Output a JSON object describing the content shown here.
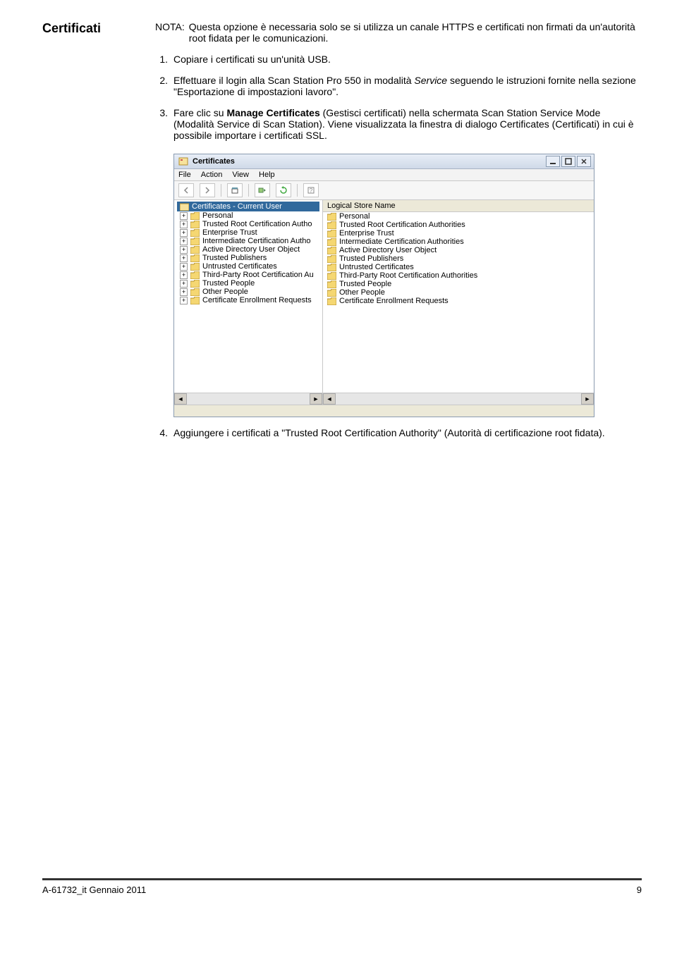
{
  "section_heading": "Certificati",
  "note": {
    "label": "NOTA:",
    "text": "Questa opzione è necessaria solo se si utilizza un canale HTTPS e certificati non firmati da un'autorità root fidata per le comunicazioni."
  },
  "steps": {
    "s1": {
      "num": "1.",
      "text": "Copiare i certificati su un'unità USB."
    },
    "s2": {
      "num": "2.",
      "pre": "Effettuare il login alla Scan Station Pro 550 in modalità ",
      "italic": "Service",
      "post": " seguendo le istruzioni fornite nella sezione \"Esportazione di impostazioni lavoro\"."
    },
    "s3": {
      "num": "3.",
      "pre": "Fare clic su ",
      "bold": "Manage Certificates",
      "post": " (Gestisci certificati) nella schermata Scan Station Service Mode (Modalità Service di Scan Station). Viene visualizzata la finestra di dialogo Certificates (Certificati) in cui è possibile importare i certificati SSL."
    },
    "s4": {
      "num": "4.",
      "text": "Aggiungere i certificati a \"Trusted Root Certification Authority\" (Autorità di certificazione root fidata)."
    }
  },
  "window": {
    "title": "Certificates",
    "menus": {
      "file": "File",
      "action": "Action",
      "view": "View",
      "help": "Help"
    },
    "tree_column": "",
    "list_column": "Logical Store Name",
    "root": "Certificates - Current User",
    "tree": [
      "Personal",
      "Trusted Root Certification Autho",
      "Enterprise Trust",
      "Intermediate Certification Autho",
      "Active Directory User Object",
      "Trusted Publishers",
      "Untrusted Certificates",
      "Third-Party Root Certification Au",
      "Trusted People",
      "Other People",
      "Certificate Enrollment Requests"
    ],
    "list": [
      "Personal",
      "Trusted Root Certification Authorities",
      "Enterprise Trust",
      "Intermediate Certification Authorities",
      "Active Directory User Object",
      "Trusted Publishers",
      "Untrusted Certificates",
      "Third-Party Root Certification Authorities",
      "Trusted People",
      "Other People",
      "Certificate Enrollment Requests"
    ]
  },
  "footer": {
    "left": "A-61732_it  Gennaio 2011",
    "right": "9"
  }
}
